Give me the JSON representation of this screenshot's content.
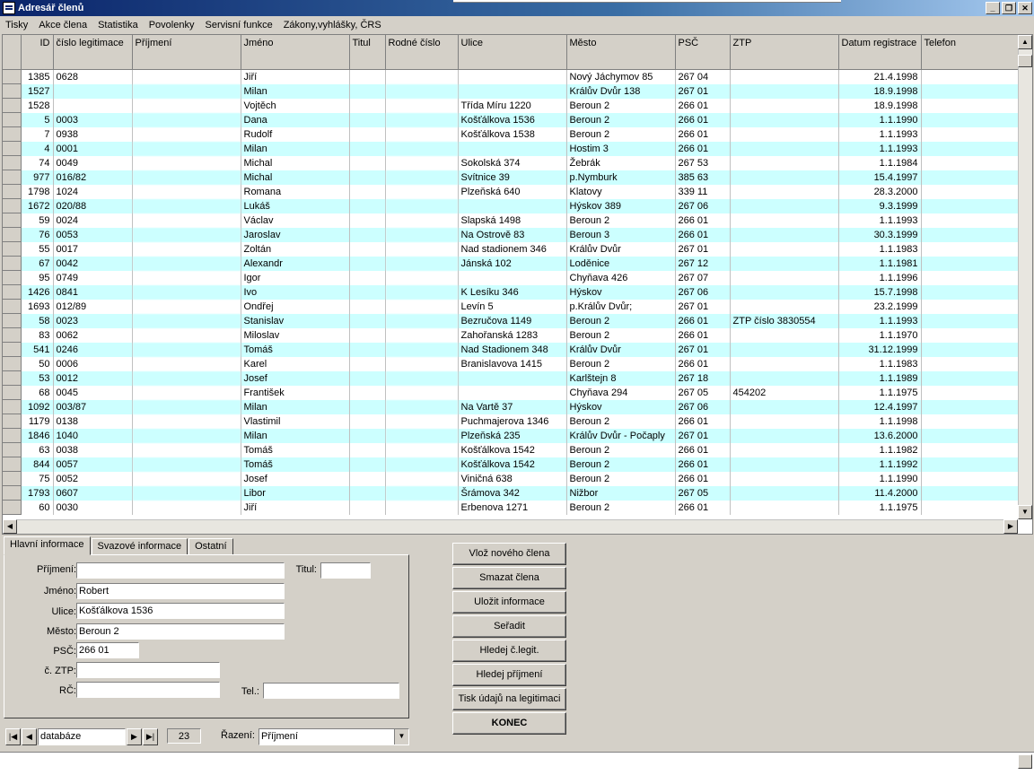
{
  "window": {
    "title": "Adresář členů"
  },
  "menu": [
    "Tisky",
    "Akce člena",
    "Statistika",
    "Povolenky",
    "Servisní funkce",
    "Zákony,vyhlášky, ČRS"
  ],
  "grid": {
    "columns": [
      "ID",
      "číslo legitimace",
      "Příjmení",
      "Jméno",
      "Titul",
      "Rodné číslo",
      "Ulice",
      "Město",
      "PSČ",
      "ZTP",
      "Datum registrace",
      "Telefon"
    ],
    "rows": [
      [
        "1385",
        "0628",
        "",
        "Jiří",
        "",
        "",
        "",
        "Nový Jáchymov 85",
        "267 04",
        "",
        "21.4.1998",
        ""
      ],
      [
        "1527",
        "",
        "",
        "Milan",
        "",
        "",
        "",
        "Králův Dvůr 138",
        "267 01",
        "",
        "18.9.1998",
        ""
      ],
      [
        "1528",
        "",
        "",
        "Vojtěch",
        "",
        "",
        "Třída Míru 1220",
        "Beroun 2",
        "266 01",
        "",
        "18.9.1998",
        ""
      ],
      [
        "5",
        "0003",
        "",
        "Dana",
        "",
        "",
        "Košťálkova 1536",
        "Beroun 2",
        "266 01",
        "",
        "1.1.1990",
        ""
      ],
      [
        "7",
        "0938",
        "",
        "Rudolf",
        "",
        "",
        "Košťálkova 1538",
        "Beroun 2",
        "266 01",
        "",
        "1.1.1993",
        ""
      ],
      [
        "4",
        "0001",
        "",
        "Milan",
        "",
        "",
        "",
        "Hostim  3",
        "266 01",
        "",
        "1.1.1993",
        ""
      ],
      [
        "74",
        "0049",
        "",
        "Michal",
        "",
        "",
        "Sokolská 374",
        "Žebrák",
        "267 53",
        "",
        "1.1.1984",
        ""
      ],
      [
        "977",
        "016/82",
        "",
        "Michal",
        "",
        "",
        "Svítnice 39",
        "p.Nymburk",
        "385 63",
        "",
        "15.4.1997",
        ""
      ],
      [
        "1798",
        "1024",
        "",
        "Romana",
        "",
        "",
        "Plzeňská 640",
        "Klatovy",
        "339 11",
        "",
        "28.3.2000",
        ""
      ],
      [
        "1672",
        "020/88",
        "",
        "Lukáš",
        "",
        "",
        "",
        "Hýskov 389",
        "267 06",
        "",
        "9.3.1999",
        ""
      ],
      [
        "59",
        "0024",
        "",
        "Václav",
        "",
        "",
        "Slapská 1498",
        "Beroun 2",
        "266 01",
        "",
        "1.1.1993",
        ""
      ],
      [
        "76",
        "0053",
        "",
        "Jaroslav",
        "",
        "",
        "Na Ostrově 83",
        "Beroun 3",
        "266 01",
        "",
        "30.3.1999",
        ""
      ],
      [
        "55",
        "0017",
        "",
        "Zoltán",
        "",
        "",
        "Nad stadionem 346",
        "Králův Dvůr",
        "267 01",
        "",
        "1.1.1983",
        ""
      ],
      [
        "67",
        "0042",
        "",
        "Alexandr",
        "",
        "",
        "Jánská 102",
        "Loděnice",
        "267 12",
        "",
        "1.1.1981",
        ""
      ],
      [
        "95",
        "0749",
        "",
        "Igor",
        "",
        "",
        "",
        "Chyňava 426",
        "267 07",
        "",
        "1.1.1996",
        ""
      ],
      [
        "1426",
        "0841",
        "",
        "Ivo",
        "",
        "",
        "K Lesíku 346",
        "Hýskov",
        "267 06",
        "",
        "15.7.1998",
        ""
      ],
      [
        "1693",
        "012/89",
        "",
        "Ondřej",
        "",
        "",
        "Levín 5",
        "p.Králův Dvůr;",
        "267 01",
        "",
        "23.2.1999",
        ""
      ],
      [
        "58",
        "0023",
        "",
        "Stanislav",
        "",
        "",
        "Bezručova 1149",
        "Beroun 2",
        "266 01",
        "ZTP číslo 3830554",
        "1.1.1993",
        ""
      ],
      [
        "83",
        "0062",
        "",
        "Miloslav",
        "",
        "",
        "Zahořanská 1283",
        "Beroun 2",
        "266 01",
        "",
        "1.1.1970",
        ""
      ],
      [
        "541",
        "0246",
        "",
        "Tomáš",
        "",
        "",
        "Nad Stadionem 348",
        "Králův Dvůr",
        "267 01",
        "",
        "31.12.1999",
        ""
      ],
      [
        "50",
        "0006",
        "",
        "Karel",
        "",
        "",
        "Branislavova 1415",
        "Beroun 2",
        "266 01",
        "",
        "1.1.1983",
        ""
      ],
      [
        "53",
        "0012",
        "",
        "Josef",
        "",
        "",
        "",
        "Karlštejn 8",
        "267 18",
        "",
        "1.1.1989",
        ""
      ],
      [
        "68",
        "0045",
        "",
        "František",
        "",
        "",
        "",
        "Chyňava 294",
        "267 05",
        "454202",
        "1.1.1975",
        ""
      ],
      [
        "1092",
        "003/87",
        "",
        "Milan",
        "",
        "",
        "Na Vartě 37",
        "Hýskov",
        "267 06",
        "",
        "12.4.1997",
        ""
      ],
      [
        "1179",
        "0138",
        "",
        "Vlastimil",
        "",
        "",
        "Puchmajerova 1346",
        "Beroun 2",
        "266 01",
        "",
        "1.1.1998",
        ""
      ],
      [
        "1846",
        "1040",
        "",
        "Milan",
        "",
        "",
        "Plzeňská 235",
        "Králův Dvůr - Počaply",
        "267 01",
        "",
        "13.6.2000",
        ""
      ],
      [
        "63",
        "0038",
        "",
        "Tomáš",
        "",
        "",
        "Košťálkova 1542",
        "Beroun 2",
        "266 01",
        "",
        "1.1.1982",
        ""
      ],
      [
        "844",
        "0057",
        "",
        "Tomáš",
        "",
        "",
        "Košťálkova 1542",
        "Beroun 2",
        "266 01",
        "",
        "1.1.1992",
        ""
      ],
      [
        "75",
        "0052",
        "",
        "Josef",
        "",
        "",
        "Viničná 638",
        "Beroun 2",
        "266 01",
        "",
        "1.1.1990",
        ""
      ],
      [
        "1793",
        "0607",
        "",
        "Libor",
        "",
        "",
        "Šrámova 342",
        "Nižbor",
        "267 05",
        "",
        "11.4.2000",
        ""
      ],
      [
        "60",
        "0030",
        "",
        "Jiří",
        "",
        "",
        "Erbenova 1271",
        "Beroun 2",
        "266 01",
        "",
        "1.1.1975",
        ""
      ]
    ]
  },
  "tabs": [
    "Hlavní informace",
    "Svazové informace",
    "Ostatní"
  ],
  "form": {
    "prijmeni_label": "Příjmení:",
    "titul_label": "Titul:",
    "jmeno_label": "Jméno:",
    "jmeno_value": "Robert",
    "ulice_label": "Ulice:",
    "ulice_value": "Košťálkova 1536",
    "mesto_label": "Město:",
    "mesto_value": "Beroun 2",
    "psc_label": "PSČ:",
    "psc_value": "266 01",
    "ztp_label": "č. ZTP:",
    "rc_label": "RČ:",
    "tel_label": "Tel.:"
  },
  "buttons": [
    "Vlož nového člena",
    "Smazat člena",
    "Uložit informace",
    "Seřadit",
    "Hledej č.legit.",
    "Hledej příjmení",
    "Tisk údajů na legitimaci",
    "KONEC"
  ],
  "nav": {
    "source": "databáze",
    "count": "23",
    "sort_label": "Řazení:",
    "sort_value": "Příjmení"
  },
  "colors": {
    "row_alt": "#ccffff",
    "title_bar": "#0a246a",
    "face": "#d4d0c8"
  }
}
